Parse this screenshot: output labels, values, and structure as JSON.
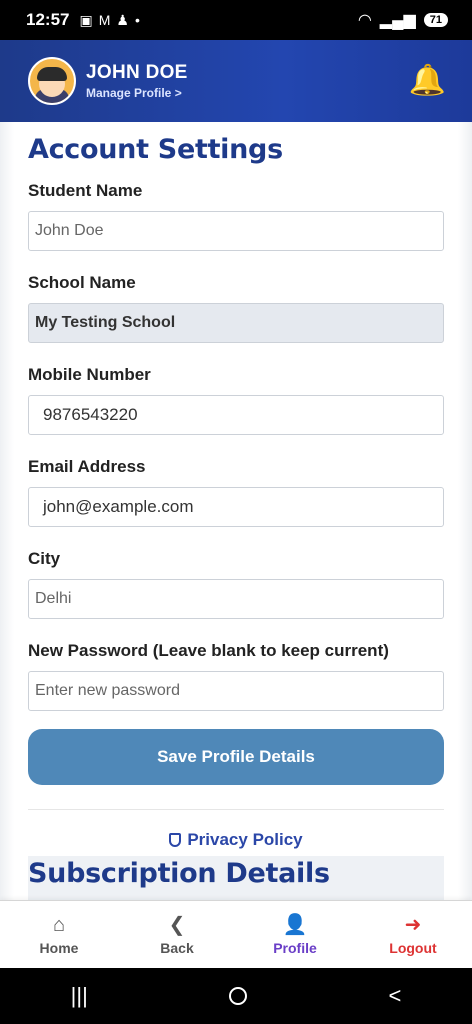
{
  "status": {
    "time": "12:57",
    "battery": "71"
  },
  "header": {
    "user_name": "JOHN DOE",
    "manage_label": "Manage Profile >"
  },
  "main": {
    "title": "Account Settings",
    "fields": {
      "student_name": {
        "label": "Student Name",
        "value": "John Doe"
      },
      "school_name": {
        "label": "School Name",
        "value": "My Testing School"
      },
      "mobile": {
        "label": "Mobile Number",
        "value": "9876543220"
      },
      "email": {
        "label": "Email Address",
        "value": "john@example.com"
      },
      "city": {
        "label": "City",
        "value": "Delhi"
      },
      "password": {
        "label": "New Password (Leave blank to keep current)",
        "placeholder": "Enter new password"
      }
    },
    "save_label": "Save Profile Details",
    "privacy_label": "Privacy Policy",
    "subscription_title": "Subscription Details"
  },
  "nav": {
    "home": "Home",
    "back": "Back",
    "profile": "Profile",
    "logout": "Logout"
  },
  "colors": {
    "header": "#1e3a8a",
    "button": "#4f88b8",
    "active": "#6a3ec7",
    "logout": "#d33333",
    "bell": "#f7c325"
  }
}
